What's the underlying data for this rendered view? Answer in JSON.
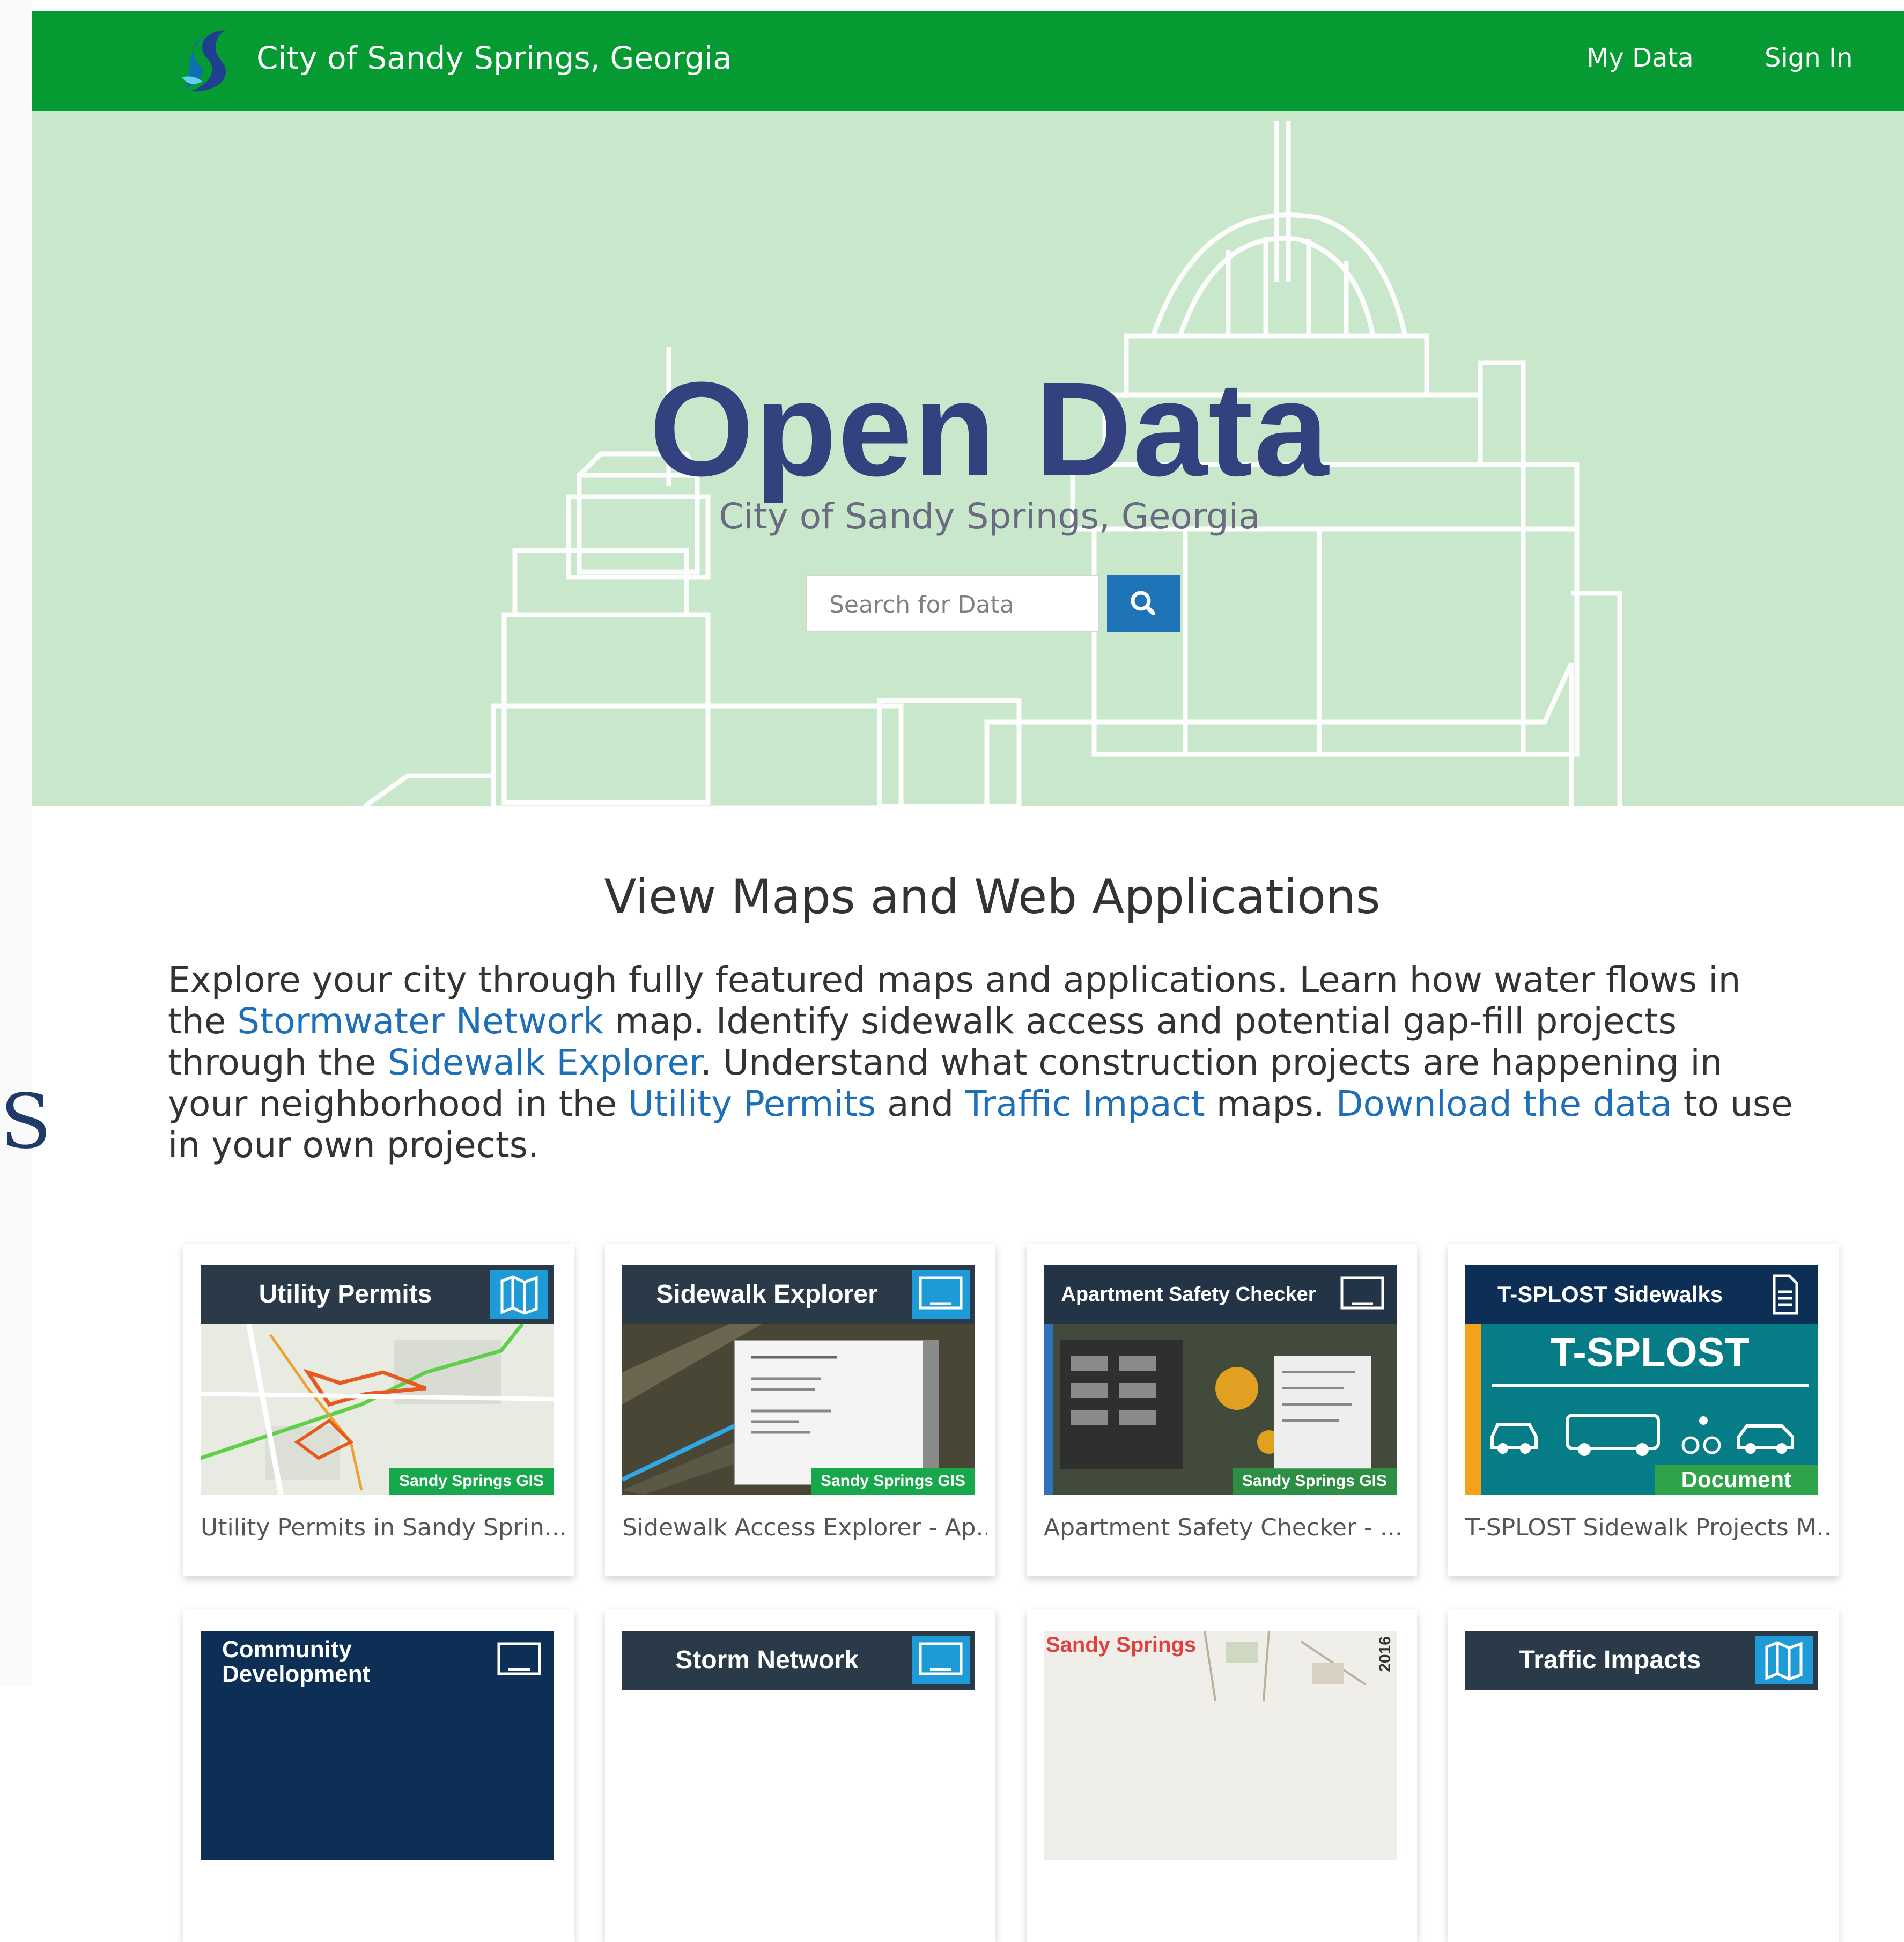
{
  "header": {
    "site_title": "City of Sandy Springs, Georgia",
    "nav": [
      "My Data",
      "Sign In"
    ]
  },
  "hero": {
    "title": "Open Data",
    "subtitle": "City of Sandy Springs, Georgia",
    "search_placeholder": "Search for Data"
  },
  "side_glyph": "S",
  "section": {
    "title": "View Maps and Web Applications",
    "intro_parts": [
      "Explore your city through fully featured maps and applications. Learn how water flows in the ",
      "Stormwater Network",
      " map. Identify sidewalk access and potential gap-fill projects through the ",
      "Sidewalk Explorer",
      ". Understand what construction projects are happening in your neighborhood in the ",
      "Utility Permits",
      " and ",
      "Traffic Impact",
      " maps. ",
      "Download the data",
      " to use in your own projects."
    ]
  },
  "cards": [
    {
      "title": "Utility Permits",
      "caption": "Utility Permits in Sandy Sprin...",
      "tag": "Sandy Springs GIS",
      "icon": "map-icon"
    },
    {
      "title": "Sidewalk Explorer",
      "caption": "Sidewalk Access Explorer - Ap...",
      "tag": "Sandy Springs GIS",
      "icon": "app-icon"
    },
    {
      "title": "Apartment Safety Checker",
      "caption": "Apartment Safety Checker - ...",
      "tag": "Sandy Springs GIS",
      "icon": "app-icon"
    },
    {
      "title": "T-SPLOST Sidewalks",
      "caption": "T-SPLOST Sidewalk Projects M...",
      "banner": "T-SPLOST",
      "tag": "Document",
      "icon": "document-icon"
    },
    {
      "title": "Community Development",
      "icon": "app-icon"
    },
    {
      "title": "Storm Network",
      "icon": "app-icon"
    },
    {
      "title": "Sandy Springs",
      "year": "2016"
    },
    {
      "title": "Traffic Impacts",
      "icon": "map-icon"
    }
  ],
  "colors": {
    "header_green": "#069a33",
    "hero_green": "#c9e8cb",
    "title_navy": "#33427f",
    "link_blue": "#1e6fb8",
    "search_blue": "#1f73b7",
    "icon_blue": "#1e9bd7",
    "card_header": "#2b3a48"
  }
}
